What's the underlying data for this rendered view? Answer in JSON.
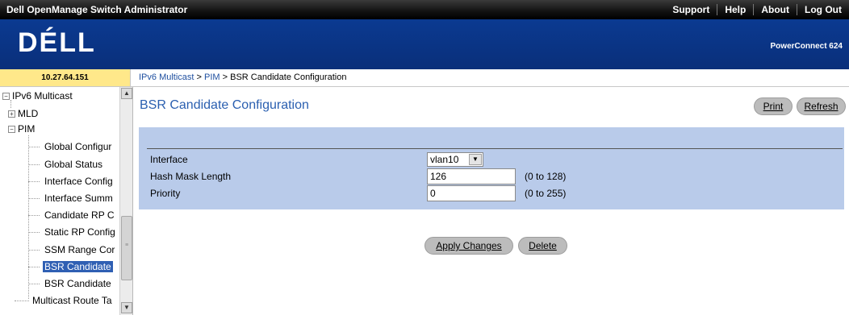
{
  "topbar": {
    "app_title": "Dell OpenManage Switch Administrator",
    "links": [
      "Support",
      "Help",
      "About",
      "Log Out"
    ]
  },
  "banner": {
    "logo": "DÉLL",
    "model": "PowerConnect 624"
  },
  "ip_address": "10.27.64.151",
  "breadcrumb": {
    "items": [
      "IPv6 Multicast",
      "PIM",
      "BSR Candidate Configuration"
    ],
    "separator": " > "
  },
  "sidebar": {
    "items": [
      {
        "label": "IPv6 Multicast",
        "toggle": "−"
      },
      {
        "label": "MLD",
        "toggle": "+"
      },
      {
        "label": "PIM",
        "toggle": "−"
      },
      {
        "label": "Global Configur"
      },
      {
        "label": "Global Status"
      },
      {
        "label": "Interface Config"
      },
      {
        "label": "Interface Summ"
      },
      {
        "label": "Candidate RP C"
      },
      {
        "label": "Static RP Config"
      },
      {
        "label": "SSM Range Cor"
      },
      {
        "label": "BSR Candidate"
      },
      {
        "label": "BSR Candidate"
      },
      {
        "label": "Multicast Route Ta"
      }
    ]
  },
  "page": {
    "title": "BSR Candidate Configuration",
    "print_label": "Print",
    "refresh_label": "Refresh"
  },
  "form": {
    "interface": {
      "label": "Interface",
      "value": "vlan10"
    },
    "hash_mask_length": {
      "label": "Hash Mask Length",
      "value": "126",
      "range": "(0 to 128)"
    },
    "priority": {
      "label": "Priority",
      "value": "0",
      "range": "(0 to 255)"
    }
  },
  "actions": {
    "apply_label": "Apply Changes",
    "delete_label": "Delete"
  },
  "colors": {
    "banner": "#0b3a91",
    "panel": "#b9cbea",
    "title": "#2a5fb0",
    "ip_cell": "#ffe88a",
    "selected": "#2f5fb3"
  }
}
